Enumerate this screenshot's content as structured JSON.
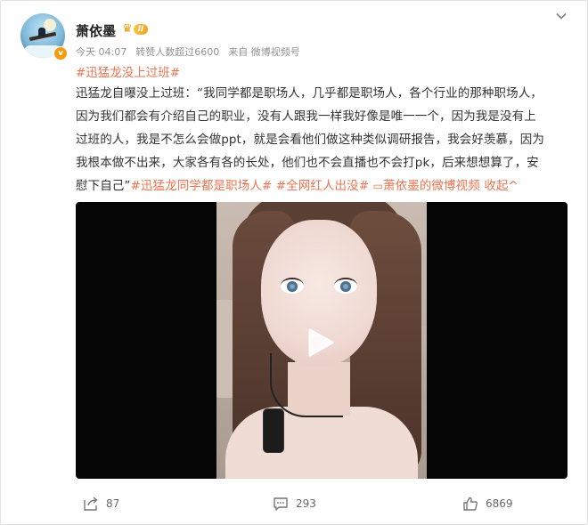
{
  "author": {
    "name": "萧依墨",
    "level_badge": "II",
    "verified_mark": "v",
    "avatar_icon": "avatar-witch-on-broom"
  },
  "meta": {
    "time": "今天 04:07",
    "reposts_note": "转赞人数超过6600",
    "source": "来自 微博视频号"
  },
  "post": {
    "topic_tag": "#迅猛龙没上过班#",
    "body": "迅猛龙自曝没上过班：“我同学都是职场人，几乎都是职场人，各个行业的那种职场人，\n因为我们都会有介绍自己的职业，没有人跟我一样我好像是唯一一个，因为我是没有上\n过班的人，我是不怎么会做ppt，就是会看他们做这种类似调研报告，我会好羡慕，因为\n我根本做不出来，大家各有各的长处，他们也不会直播也不会打pk，后来想想算了，安\n慰下自己”",
    "tag2": "#迅猛龙同学都是职场人#",
    "tag3": "#全网红人出没#",
    "video_link_icon": "▭",
    "video_link": "萧依墨的微博视频",
    "collapse": "收起",
    "collapse_icon": "^"
  },
  "video": {
    "play_icon": "play-icon"
  },
  "actions": {
    "forward_count": "87",
    "comment_count": "293",
    "like_count": "6869"
  },
  "colors": {
    "link": "#eb7350",
    "meta": "#939393",
    "text": "#333333"
  }
}
